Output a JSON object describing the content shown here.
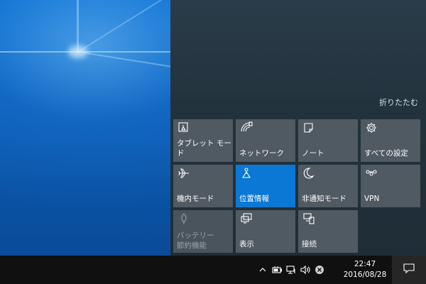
{
  "action_center": {
    "collapse_label": "折りたたむ",
    "tiles": [
      {
        "label": "タブレット モード",
        "icon": "tablet-mode-icon",
        "state": "off"
      },
      {
        "label": "ネットワーク",
        "icon": "network-icon",
        "state": "off"
      },
      {
        "label": "ノート",
        "icon": "note-icon",
        "state": "off"
      },
      {
        "label": "すべての設定",
        "icon": "gear-icon",
        "state": "off"
      },
      {
        "label": "機内モード",
        "icon": "airplane-icon",
        "state": "off"
      },
      {
        "label": "位置情報",
        "icon": "location-icon",
        "state": "on"
      },
      {
        "label": "非通知モード",
        "icon": "moon-icon",
        "state": "off"
      },
      {
        "label": "VPN",
        "icon": "vpn-icon",
        "state": "off"
      },
      {
        "label": "バッテリー\n節約機能",
        "icon": "battery-saver-icon",
        "state": "disabled"
      },
      {
        "label": "表示",
        "icon": "display-icon",
        "state": "off"
      },
      {
        "label": "接続",
        "icon": "connect-icon",
        "state": "off"
      }
    ],
    "active_color": "#0a78d4",
    "tile_color": "#505a62"
  },
  "taskbar": {
    "tray_icons": [
      "chevron-up-icon",
      "battery-icon",
      "network-wired-icon",
      "volume-icon",
      "close-circle-icon"
    ],
    "clock": {
      "time": "22:47",
      "date": "2016/08/28"
    },
    "action_center_icon": "notification-icon"
  }
}
